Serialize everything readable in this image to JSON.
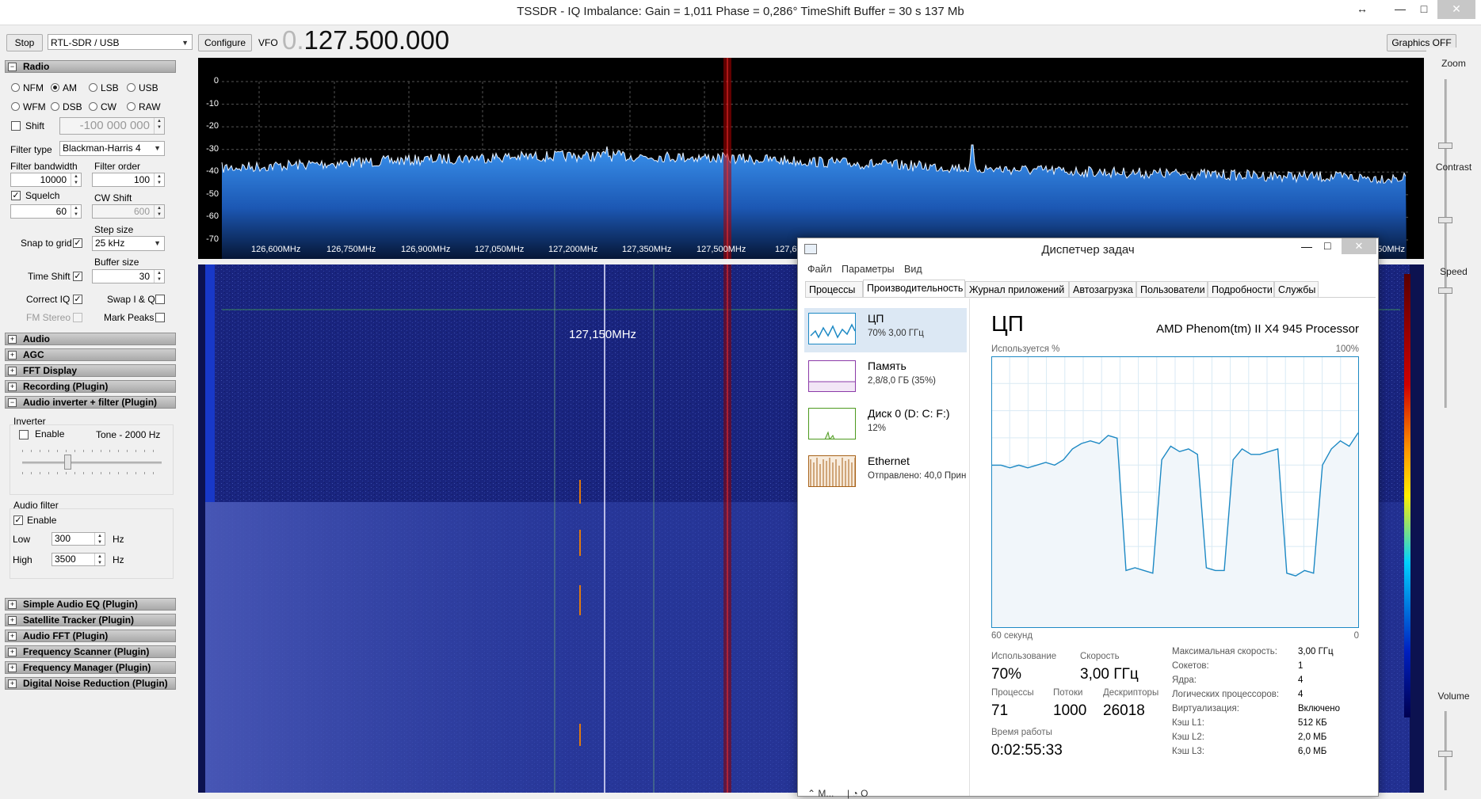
{
  "window": {
    "title": "TSSDR - IQ Imbalance: Gain = 1,011 Phase = 0,286° TimeShift Buffer = 30 s  137 Mb",
    "restore_icon": "↔",
    "minimize_icon": "—",
    "maximize_icon": "□",
    "close_icon": "✕"
  },
  "toolbar": {
    "stop_label": "Stop",
    "device": "RTL-SDR / USB",
    "configure_label": "Configure",
    "vfo_label": "VFO",
    "vfo_prefix": "0.",
    "vfo_value": "127.500.000",
    "graphics_label": "Graphics OFF"
  },
  "radio": {
    "section_label": "Radio",
    "modes_row1": [
      "NFM",
      "AM",
      "LSB",
      "USB"
    ],
    "modes_row2": [
      "WFM",
      "DSB",
      "CW",
      "RAW"
    ],
    "selected_mode": "AM",
    "shift_label": "Shift",
    "shift_value": "-100 000 000",
    "filter_type_label": "Filter type",
    "filter_type_value": "Blackman-Harris 4",
    "filter_bandwidth_label": "Filter bandwidth",
    "filter_bandwidth_value": "10000",
    "filter_order_label": "Filter order",
    "filter_order_value": "100",
    "squelch_label": "Squelch",
    "squelch_value": "60",
    "cw_shift_label": "CW Shift",
    "cw_shift_value": "600",
    "snap_label": "Snap to grid",
    "step_size_label": "Step size",
    "step_size_value": "25 kHz",
    "buffer_size_label": "Buffer size",
    "buffer_size_value": "30",
    "time_shift_label": "Time Shift",
    "correct_iq_label": "Correct IQ",
    "swap_iq_label": "Swap I & Q",
    "fm_stereo_label": "FM Stereo",
    "mark_peaks_label": "Mark Peaks"
  },
  "sections_top": [
    "Audio",
    "AGC",
    "FFT Display",
    "Recording (Plugin)"
  ],
  "audio_inverter": {
    "section_label": "Audio inverter + filter (Plugin)",
    "inverter_group": "Inverter",
    "enable_label": "Enable",
    "tone_label": "Tone - 2000 Hz",
    "filter_group": "Audio filter",
    "filter_enable_label": "Enable",
    "low_label": "Low",
    "low_value": "300",
    "high_label": "High",
    "high_value": "3500",
    "hz_label": "Hz"
  },
  "sections_bottom": [
    "Simple Audio EQ (Plugin)",
    "Satellite Tracker (Plugin)",
    "Audio FFT (Plugin)",
    "Frequency Scanner (Plugin)",
    "Frequency Manager (Plugin)",
    "Digital Noise Reduction (Plugin)"
  ],
  "spectrum": {
    "y_ticks": [
      "0",
      "-10",
      "-20",
      "-30",
      "-40",
      "-50",
      "-60",
      "-70"
    ],
    "x_ticks": [
      "126,600MHz",
      "126,750MHz",
      "126,900MHz",
      "127,050MHz",
      "127,200MHz",
      "127,350MHz",
      "127,500MHz",
      "127,6",
      "850MHz"
    ]
  },
  "waterfall": {
    "marker_label": "127,150MHz"
  },
  "right_panel": {
    "zoom_label": "Zoom",
    "contrast_label": "Contrast",
    "speed_label": "Speed",
    "volume_label": "Volume"
  },
  "task_manager": {
    "title": "Диспетчер задач",
    "menu": [
      "Файл",
      "Параметры",
      "Вид"
    ],
    "tabs": [
      "Процессы",
      "Производительность",
      "Журнал приложений",
      "Автозагрузка",
      "Пользователи",
      "Подробности",
      "Службы"
    ],
    "active_tab": "Производительность",
    "items": [
      {
        "name": "ЦП",
        "sub": "70% 3,00 ГГц"
      },
      {
        "name": "Память",
        "sub": "2,8/8,0 ГБ (35%)"
      },
      {
        "name": "Диск 0 (D: C: F:)",
        "sub": "12%"
      },
      {
        "name": "Ethernet",
        "sub": "Отправлено: 40,0 Прин"
      }
    ],
    "cpu_heading": "ЦП",
    "cpu_model": "AMD Phenom(tm) II X4 945 Processor",
    "usage_axis_label": "Используется %",
    "usage_axis_max": "100%",
    "time_axis_left": "60 секунд",
    "time_axis_right": "0",
    "stats": {
      "usage_label": "Использование",
      "usage_value": "70%",
      "speed_label": "Скорость",
      "speed_value": "3,00 ГГц",
      "processes_label": "Процессы",
      "processes_value": "71",
      "threads_label": "Потоки",
      "threads_value": "1000",
      "handles_label": "Дескрипторы",
      "handles_value": "26018",
      "uptime_label": "Время работы",
      "uptime_value": "0:02:55:33"
    },
    "details": [
      {
        "k": "Максимальная скорость:",
        "v": "3,00 ГГц"
      },
      {
        "k": "Сокетов:",
        "v": "1"
      },
      {
        "k": "Ядра:",
        "v": "4"
      },
      {
        "k": "Логических процессоров:",
        "v": "4"
      },
      {
        "k": "Виртуализация:",
        "v": "Включено"
      },
      {
        "k": "Кэш L1:",
        "v": "512 КБ"
      },
      {
        "k": "Кэш L2:",
        "v": "2,0 МБ"
      },
      {
        "k": "Кэш L3:",
        "v": "6,0 МБ"
      }
    ],
    "cpu_history_percent": [
      60,
      60,
      59,
      60,
      59,
      60,
      61,
      60,
      62,
      66,
      68,
      69,
      68,
      71,
      70,
      21,
      22,
      21,
      20,
      62,
      67,
      65,
      66,
      64,
      22,
      21,
      21,
      62,
      66,
      64,
      64,
      65,
      66,
      20,
      19,
      21,
      20,
      60,
      66,
      69,
      67,
      72
    ]
  },
  "colors": {
    "spectrum_fill": "#1f6fd0",
    "waterfall_bg": "#0b0e3a",
    "cpu_graph_line": "#1d89c4",
    "cpu_graph_fill": "#f1f6fa"
  }
}
